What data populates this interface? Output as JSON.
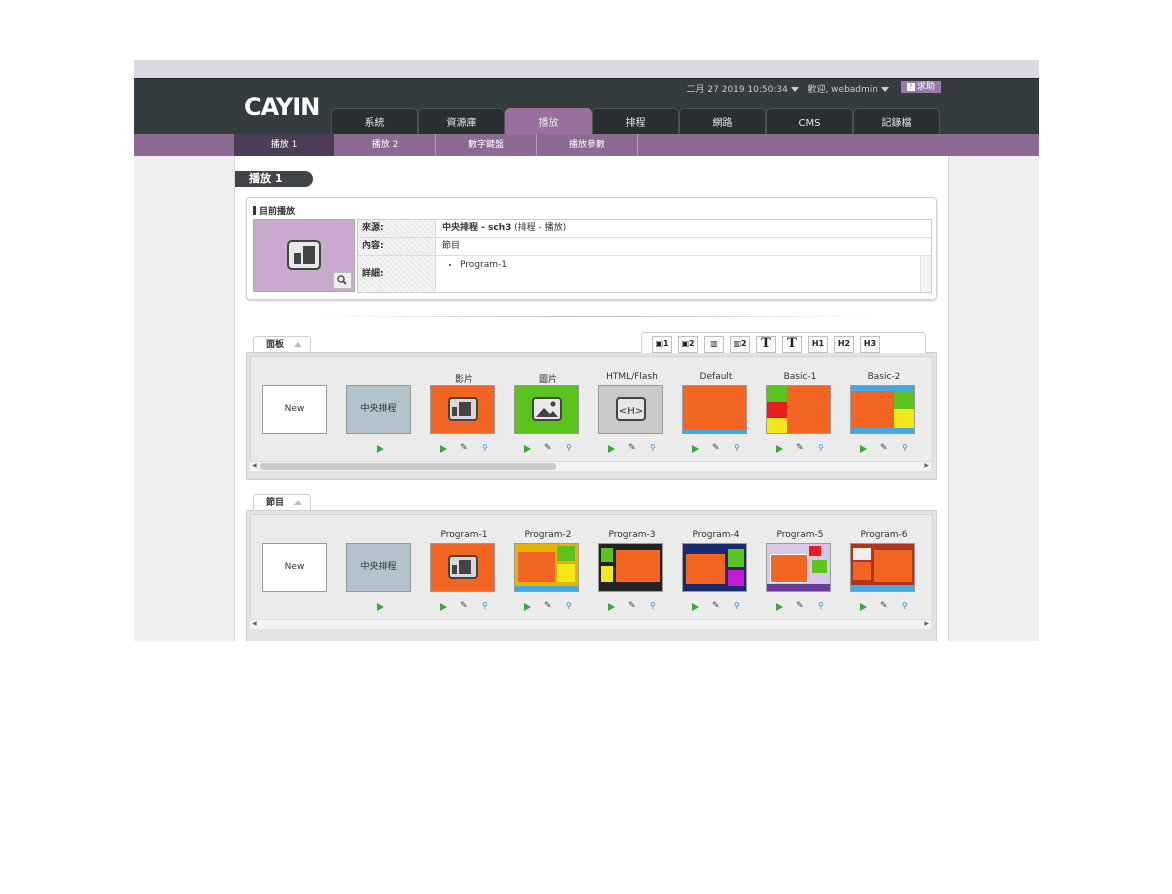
{
  "header": {
    "logo": "CAYIN",
    "datetime": "二月 27 2019 10:50:34",
    "welcome": "歡迎, webadmin",
    "help": "求助"
  },
  "tabs": [
    "系統",
    "資源庫",
    "播放",
    "排程",
    "網路",
    "CMS",
    "記錄檔"
  ],
  "active_tab": "播放",
  "subtabs": [
    "播放 1",
    "播放 2",
    "數字鍵盤",
    "播放參數"
  ],
  "active_subtab": "播放 1",
  "page_title": "播放 1",
  "now_playing": {
    "title": "目前播放",
    "source_label": "來源:",
    "source_value": "中央排程 - sch3",
    "source_note": "(排程 - 播放)",
    "content_label": "內容:",
    "content_value": "節目",
    "detail_label": "詳細:",
    "detail_items": [
      "Program-1"
    ]
  },
  "panel_section": {
    "tab": "面板",
    "toolbar_icons": [
      "video-1-icon",
      "video-2-icon",
      "image-1-icon",
      "image-2-icon",
      "text-1-icon",
      "text-2-icon",
      "html-1-icon",
      "html-2-icon",
      "html-3-icon"
    ],
    "cards": [
      {
        "label": "",
        "box": "New"
      },
      {
        "label": "",
        "box": "中央排程"
      },
      {
        "label": "影片",
        "box": ""
      },
      {
        "label": "圖片",
        "box": ""
      },
      {
        "label": "HTML/Flash",
        "box": ""
      },
      {
        "label": "Default",
        "box": ""
      },
      {
        "label": "Basic-1",
        "box": ""
      },
      {
        "label": "Basic-2",
        "box": ""
      }
    ]
  },
  "program_section": {
    "tab": "節目",
    "cards": [
      {
        "label": "",
        "box": "New"
      },
      {
        "label": "",
        "box": "中央排程"
      },
      {
        "label": "Program-1",
        "box": ""
      },
      {
        "label": "Program-2",
        "box": ""
      },
      {
        "label": "Program-3",
        "box": ""
      },
      {
        "label": "Program-4",
        "box": ""
      },
      {
        "label": "Program-5",
        "box": ""
      },
      {
        "label": "Program-6",
        "box": ""
      }
    ]
  },
  "colors": {
    "header_bg": "#353c40",
    "accent_purple": "#8c6a91",
    "orange": "#f26522",
    "play_green": "#3aa93a"
  }
}
